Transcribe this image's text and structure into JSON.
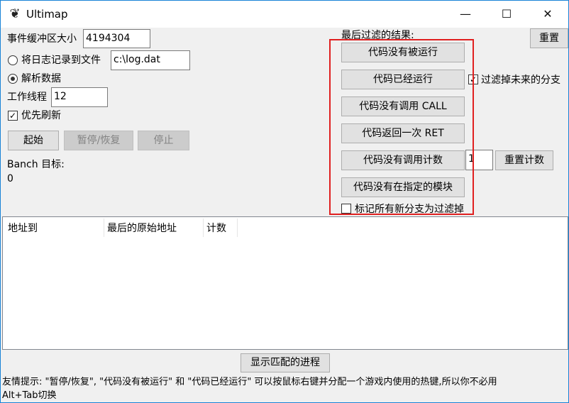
{
  "window": {
    "title": "Ultimap",
    "controls": {
      "minimize": "—",
      "maximize": "☐",
      "close": "✕"
    }
  },
  "left": {
    "buffer_label": "事件缓冲区大小",
    "buffer_value": "4194304",
    "log_to_file_label": "将日志记录到文件",
    "log_file_value": "c:\\log.dat",
    "parse_data_label": "解析数据",
    "worker_threads_label": "工作线程",
    "worker_threads_value": "12",
    "priority_flush_label": "优先刷新",
    "start_button": "起始",
    "pause_resume_button": "暂停/恢复",
    "stop_button": "停止",
    "branch_target_label": "Banch 目标:",
    "branch_target_value": "0"
  },
  "right": {
    "last_filter_label": "最后过滤的结果:",
    "reset_button": "重置",
    "filter_not_executed": "代码没有被运行",
    "filter_executed": "代码已经运行",
    "filter_future_branches_label": "过滤掉未来的分支",
    "filter_no_call": "代码没有调用 CALL",
    "filter_return_once_ret": "代码返回一次 RET",
    "filter_no_call_count": "代码没有调用计数",
    "call_count_value": "1",
    "reset_count_button": "重置计数",
    "filter_not_in_module": "代码没有在指定的模块",
    "mark_new_branches_label": "标记所有新分支为过滤掉"
  },
  "table": {
    "columns": [
      "地址到",
      "最后的原始地址",
      "计数"
    ],
    "rows": []
  },
  "bottom": {
    "show_matching_process_button": "显示匹配的进程",
    "hint_line1": "友情提示: \"暂停/恢复\", \"代码没有被运行\" 和 \"代码已经运行\" 可以按鼠标右键并分配一个游戏内使用的热键,所以你不必用",
    "hint_line2": "Alt+Tab切换"
  }
}
